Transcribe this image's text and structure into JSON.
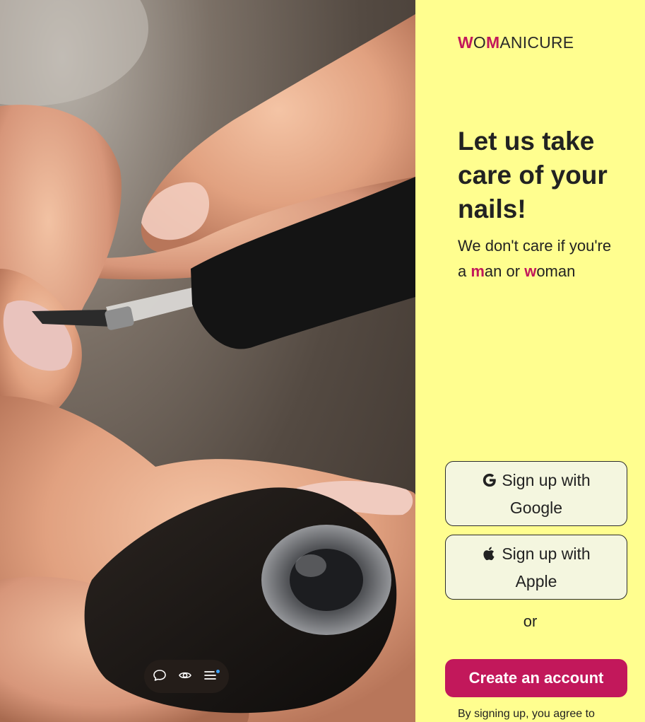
{
  "brand": {
    "logo_w": "W",
    "logo_o": "O",
    "logo_m": "M",
    "logo_rest": "ANICURE"
  },
  "hero": {
    "headline": "Let us take care of your nails!",
    "tagline_1": "We don't care if you're a ",
    "tagline_m": "m",
    "tagline_2": "an or ",
    "tagline_w": "w",
    "tagline_3": "oman"
  },
  "auth": {
    "google_label": "Sign up with Google",
    "apple_label": "Sign up with Apple",
    "or_text": "or",
    "create_label": "Create an account",
    "terms_text": "By signing up, you agree to"
  },
  "floating_toolbar": {
    "icons": [
      "chat-icon",
      "eye-icon",
      "menu-icon"
    ]
  },
  "colors": {
    "accent": "#c2185b",
    "panel_bg": "#fffe8f",
    "button_bg": "#f4f6df",
    "toolbar_bg": "#241d19",
    "notification_dot": "#3da3ff"
  }
}
